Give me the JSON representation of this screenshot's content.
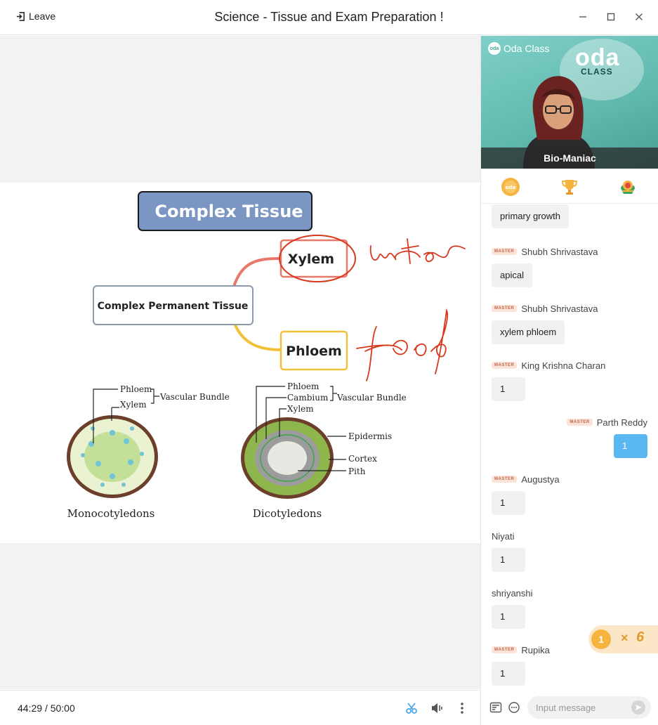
{
  "header": {
    "leave_label": "Leave",
    "title": "Science - Tissue and Exam Preparation !"
  },
  "slide": {
    "heading": "Complex Tissue",
    "root_label": "Complex Permanent Tissue",
    "branch_xylem": "Xylem",
    "branch_phloem": "Phloem",
    "handwriting_water": "water",
    "handwriting_food": "food",
    "mono_phloem": "Phloem",
    "mono_xylem": "Xylem",
    "mono_bundle": "Vascular Bundle",
    "mono_caption": "Monocotyledons",
    "di_phloem": "Phloem",
    "di_cambium": "Cambium",
    "di_xylem": "Xylem",
    "di_bundle": "Vascular Bundle",
    "di_epidermis": "Epidermis",
    "di_cortex": "Cortex",
    "di_pith": "Pith",
    "di_caption": "Dicotyledons"
  },
  "player": {
    "elapsed": "44:29",
    "separator": "/",
    "total": "50:00"
  },
  "video": {
    "brand": "Oda Class",
    "brand_mark": "oda",
    "poster_word1": "oda",
    "poster_word2": "CLASS",
    "teacher_name": "Bio-Maniac"
  },
  "chat": {
    "badge_label": "MASTER",
    "messages": [
      {
        "sender": "",
        "text": "primary growth"
      },
      {
        "sender": "Shubh Shrivastava",
        "text": "apical"
      },
      {
        "sender": "Shubh Shrivastava",
        "text": "xylem phloem"
      },
      {
        "sender": "King Krishna Charan",
        "text": "1"
      },
      {
        "sender": "Parth Reddy",
        "text": "1"
      },
      {
        "sender": "Augustya",
        "text": "1"
      },
      {
        "sender": "Niyati",
        "text": "1"
      },
      {
        "sender": "shriyanshi",
        "text": "1"
      },
      {
        "sender": "Rupika",
        "text": "1"
      }
    ],
    "input_placeholder": "Input message"
  },
  "reaction": {
    "coin": "1",
    "times": "×",
    "count": "6"
  },
  "colors": {
    "accent_blue": "#5bb7f0",
    "heading_fill": "#7b96c2",
    "xylem_stroke": "#e8786a",
    "phloem_stroke": "#f2c13a",
    "ink_red": "#d8391e"
  }
}
